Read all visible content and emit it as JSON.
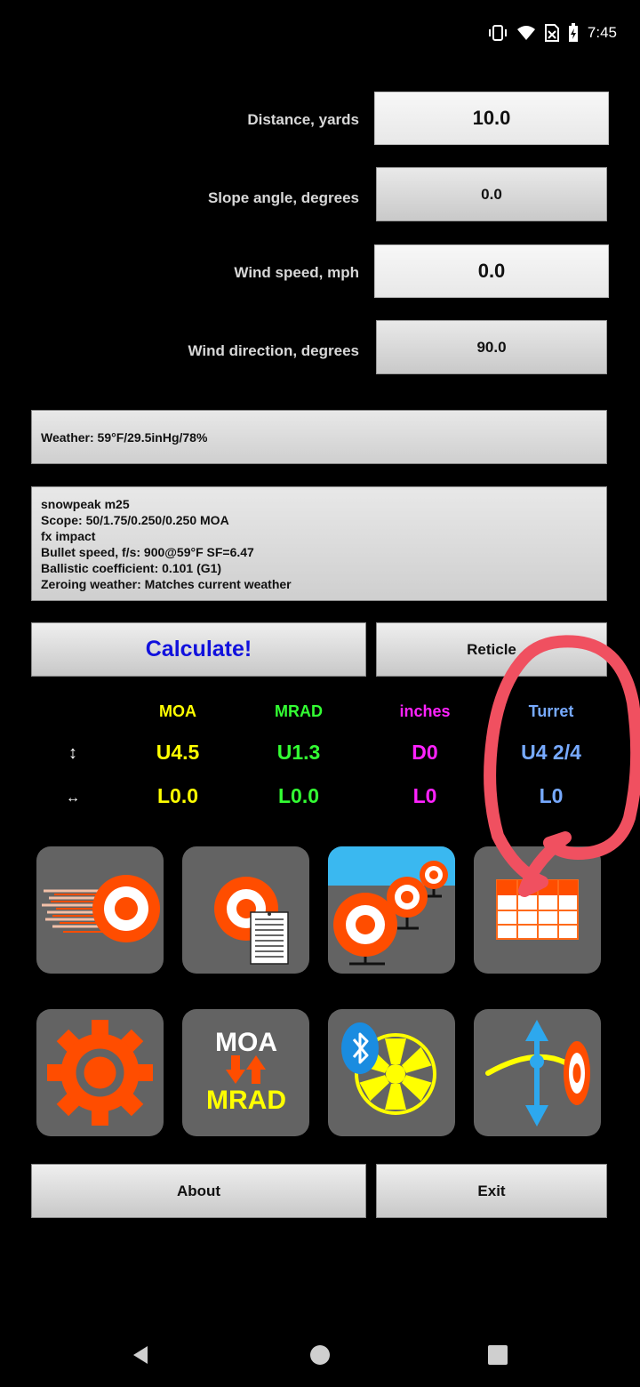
{
  "status_bar": {
    "time": "7:45"
  },
  "inputs": {
    "distance": {
      "label": "Distance, yards",
      "value": "10.0"
    },
    "slope": {
      "label": "Slope angle, degrees",
      "value": "0.0"
    },
    "wind_speed": {
      "label": "Wind speed, mph",
      "value": "0.0"
    },
    "wind_direction": {
      "label": "Wind direction, degrees",
      "value": "90.0"
    }
  },
  "weather": "Weather: 59°F/29.5inHg/78%",
  "profile": {
    "lines": [
      "snowpeak m25",
      "Scope: 50/1.75/0.250/0.250 MOA",
      "fx impact",
      "Bullet speed, f/s: 900@59°F SF=6.47",
      "Ballistic coefficient: 0.101 (G1)",
      "Zeroing weather: Matches current weather"
    ]
  },
  "buttons": {
    "calculate": "Calculate!",
    "reticle": "Reticle",
    "about": "About",
    "exit": "Exit"
  },
  "results": {
    "headers": {
      "moa": "MOA",
      "mrad": "MRAD",
      "inches": "inches",
      "turret": "Turret"
    },
    "vertical": {
      "symbol": "↕",
      "moa": "U4.5",
      "mrad": "U1.3",
      "inches": "D0",
      "turret": "U4 2/4"
    },
    "horizontal": {
      "symbol": "↔",
      "moa": "L0.0",
      "mrad": "L0.0",
      "inches": "L0",
      "turret": "L0"
    }
  },
  "tiles": {
    "conversion_top": "MOA",
    "conversion_bottom": "MRAD"
  },
  "colors": {
    "moa": "#ffff00",
    "mrad": "#33ff33",
    "inches": "#ff22ff",
    "turret": "#77aaff",
    "calculate": "#1111dd",
    "annotation": "#f05060",
    "target": "#ff4d00"
  }
}
